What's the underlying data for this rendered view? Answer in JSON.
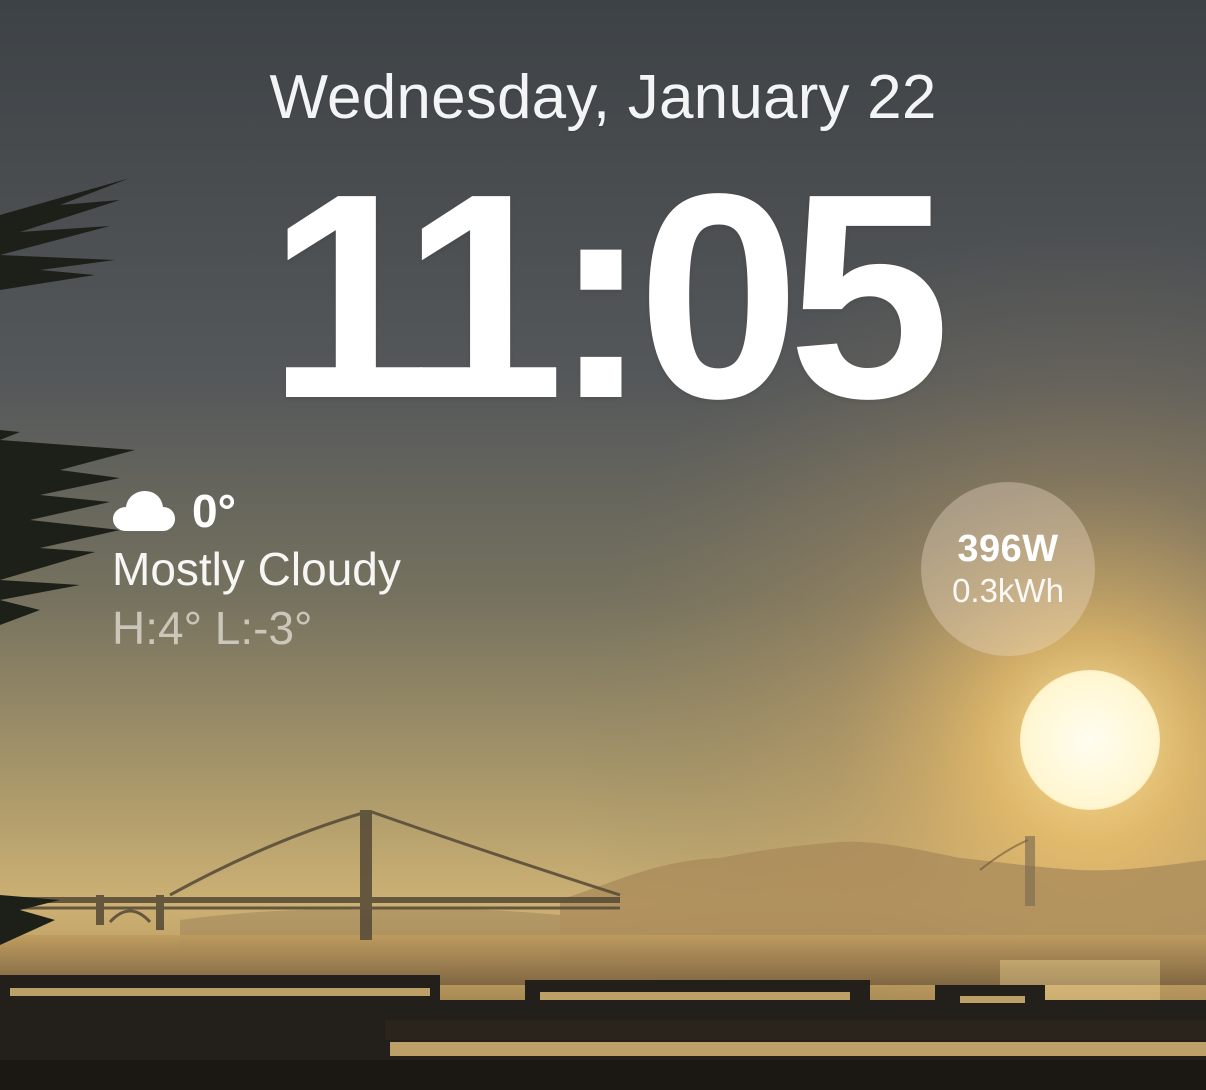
{
  "lockscreen": {
    "date": "Wednesday, January 22",
    "time": "11:05"
  },
  "weather": {
    "icon": "cloud-icon",
    "temperature": "0°",
    "condition": "Mostly Cloudy",
    "high_low": "H:4° L:-3°"
  },
  "energy_widget": {
    "power": "396W",
    "energy": "0.3kWh"
  },
  "wallpaper": {
    "subject": "golden-gate-bridge-sunset",
    "colors": {
      "sky_top": "#3f4448",
      "sky_mid": "#6d6a5d",
      "horizon": "#d6b474",
      "sun": "#fff8dc",
      "silhouette": "#1e1d1b"
    }
  }
}
